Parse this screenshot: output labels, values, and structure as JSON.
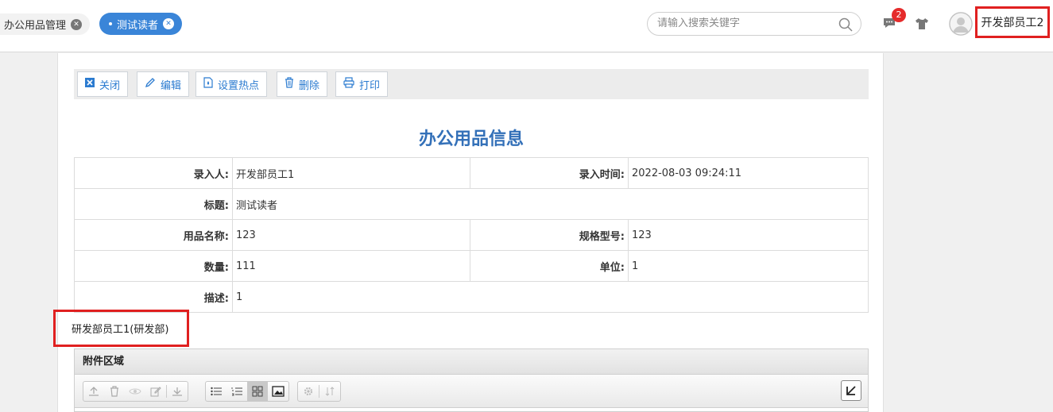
{
  "tabs": [
    {
      "label": "办公用品管理",
      "active": false
    },
    {
      "label": "测试读者",
      "active": true
    }
  ],
  "header": {
    "search_placeholder": "请输入搜索关键字",
    "message_count": "2",
    "username": "开发部员工2"
  },
  "toolbar": {
    "close_label": "关闭",
    "edit_label": "编辑",
    "hotspot_label": "设置热点",
    "delete_label": "删除",
    "print_label": "打印"
  },
  "page_title": "办公用品信息",
  "info": {
    "entered_by_label": "录入人:",
    "entered_by": "开发部员工1",
    "entry_time_label": "录入时间:",
    "entry_time": "2022-08-03 09:24:11",
    "title_label": "标题:",
    "title": "测试读者",
    "item_name_label": "用品名称:",
    "item_name": "123",
    "spec_label": "规格型号:",
    "spec": "123",
    "quantity_label": "数量:",
    "quantity": "111",
    "unit_label": "单位:",
    "unit": "1",
    "description_label": "描述:",
    "description": "1"
  },
  "dept_note": "研发部员工1(研发部)",
  "attachment": {
    "title": "附件区域"
  },
  "colors": {
    "accent": "#3a85d8",
    "title": "#3370b8",
    "highlight_border": "#e02020",
    "badge": "#e52b2b"
  }
}
